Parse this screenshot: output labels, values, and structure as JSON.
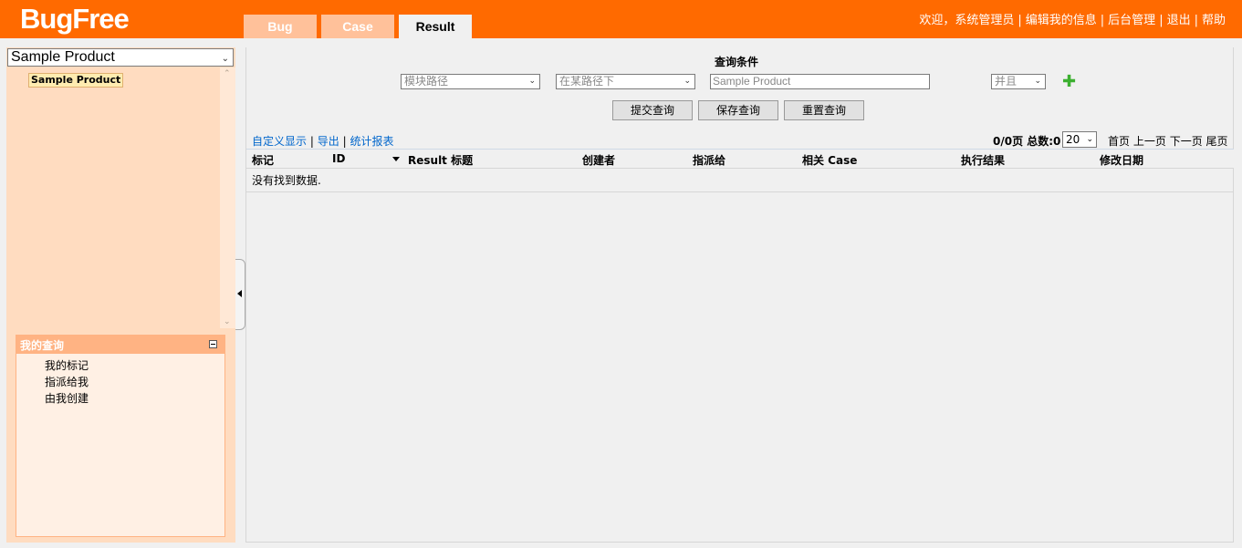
{
  "header": {
    "logo": "BugFree",
    "tabs": [
      {
        "label": "Bug"
      },
      {
        "label": "Case"
      },
      {
        "label": "Result"
      }
    ],
    "user_links": {
      "welcome": "欢迎，系统管理员",
      "edit_info": "编辑我的信息",
      "admin": "后台管理",
      "logout": "退出",
      "help": "帮助"
    }
  },
  "sidebar": {
    "product_select": "Sample Product",
    "tree_root": "Sample Product",
    "my_query": {
      "title": "我的查询",
      "items": [
        "我的标记",
        "指派给我",
        "由我创建"
      ]
    }
  },
  "query": {
    "title": "查询条件",
    "field_select": "模块路径",
    "operator_select": "在某路径下",
    "value_placeholder": "Sample Product",
    "logic_select": "并且",
    "buttons": {
      "submit": "提交查询",
      "save": "保存查询",
      "reset": "重置查询"
    }
  },
  "toolbar": {
    "custom_display": "自定义显示",
    "export": "导出",
    "report": "统计报表"
  },
  "pager": {
    "info": "0/0页 总数:0",
    "page_size": "20",
    "first": "首页",
    "prev": "上一页",
    "next": "下一页",
    "last": "尾页"
  },
  "table": {
    "columns": [
      "标记",
      "ID",
      "Result 标题",
      "创建者",
      "指派给",
      "相关 Case",
      "执行结果",
      "修改日期"
    ],
    "empty_message": "没有找到数据."
  }
}
